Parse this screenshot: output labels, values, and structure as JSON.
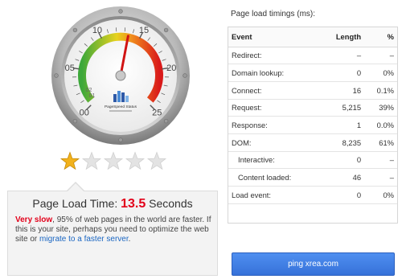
{
  "gauge": {
    "scale_labels": [
      "00",
      "05",
      "10",
      "15",
      "20",
      "25"
    ],
    "minor_labels": [
      "01",
      "02"
    ],
    "value": 13.5,
    "max": 25,
    "logo_text": "PageSpeed Status"
  },
  "rating": {
    "value": 1,
    "max": 5
  },
  "result": {
    "heading_prefix": "Page Load Time:",
    "value": "13.5",
    "heading_suffix": "Seconds",
    "slow_label": "Very slow",
    "text_1": ", 95% of web pages in the world are faster. If this is your site, perhaps you need to optimize the web site or ",
    "link": "migrate to a faster server",
    "text_2": "."
  },
  "timings": {
    "title": "Page load timings (ms):",
    "columns": [
      "Event",
      "Length",
      "%"
    ],
    "rows": [
      {
        "event": "Redirect:",
        "length": "–",
        "pct": "–",
        "indent": false
      },
      {
        "event": "Domain lookup:",
        "length": "0",
        "pct": "0%",
        "indent": false
      },
      {
        "event": "Connect:",
        "length": "16",
        "pct": "0.1%",
        "indent": false
      },
      {
        "event": "Request:",
        "length": "5,215",
        "pct": "39%",
        "indent": false
      },
      {
        "event": "Response:",
        "length": "1",
        "pct": "0.0%",
        "indent": false
      },
      {
        "event": "DOM:",
        "length": "8,235",
        "pct": "61%",
        "indent": false
      },
      {
        "event": "Interactive:",
        "length": "0",
        "pct": "–",
        "indent": true
      },
      {
        "event": "Content loaded:",
        "length": "46",
        "pct": "–",
        "indent": true
      },
      {
        "event": "Load event:",
        "length": "0",
        "pct": "0%",
        "indent": false
      }
    ]
  },
  "ping_button": "ping xrea.com",
  "colors": {
    "accent_red": "#e2001a",
    "link_blue": "#1a66c2",
    "button_blue": "#3671d9",
    "star_gold": "#f2b21c",
    "star_empty": "#e3e3e3"
  }
}
